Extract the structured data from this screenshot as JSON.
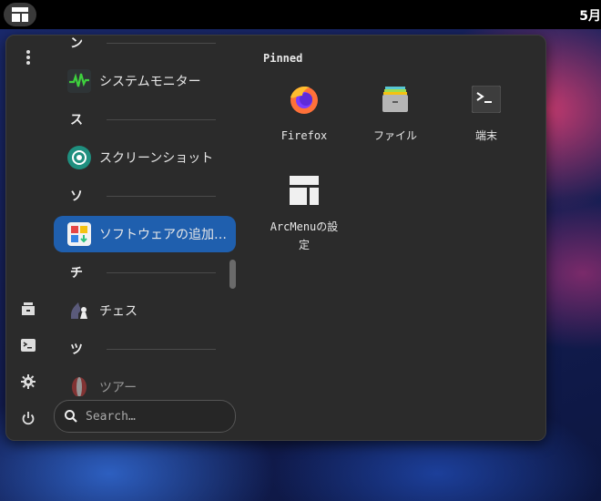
{
  "topbar": {
    "clock": "5月"
  },
  "menu": {
    "pinned_title": "Pinned",
    "search_placeholder": "Search…",
    "app_list": [
      {
        "type": "header",
        "letter": "ン"
      },
      {
        "type": "app",
        "label": "システムモニター",
        "icon": "system-monitor-icon"
      },
      {
        "type": "header",
        "letter": "ス"
      },
      {
        "type": "app",
        "label": "スクリーンショット",
        "icon": "screenshot-icon"
      },
      {
        "type": "header",
        "letter": "ソ"
      },
      {
        "type": "app",
        "label": "ソフトウェアの追加…",
        "icon": "software-icon",
        "selected": true
      },
      {
        "type": "header",
        "letter": "チ"
      },
      {
        "type": "app",
        "label": "チェス",
        "icon": "chess-icon"
      },
      {
        "type": "header",
        "letter": "ツ"
      },
      {
        "type": "app",
        "label": "ツアー",
        "icon": "tour-icon"
      }
    ],
    "pinned": [
      {
        "label": "Firefox",
        "icon": "firefox-icon"
      },
      {
        "label": "ファイル",
        "icon": "files-icon"
      },
      {
        "label": "端末",
        "icon": "terminal-icon"
      },
      {
        "label": "ArcMenuの設定",
        "icon": "arcmenu-settings-icon"
      }
    ]
  }
}
